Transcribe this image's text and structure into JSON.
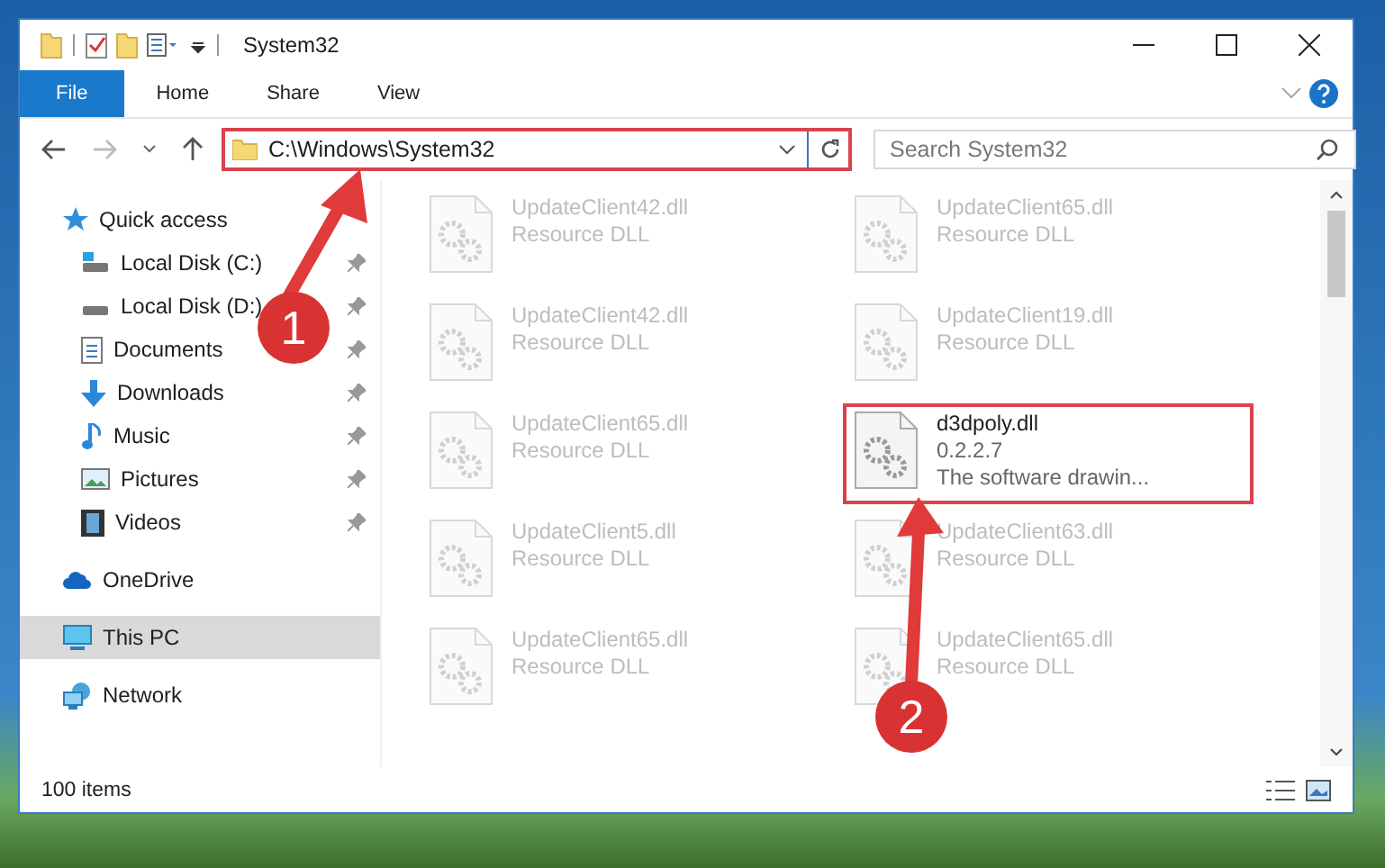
{
  "window": {
    "title": "System32"
  },
  "ribbon_tabs": [
    {
      "label": "File",
      "selected": true
    },
    {
      "label": "Home",
      "selected": false
    },
    {
      "label": "Share",
      "selected": false
    },
    {
      "label": "View",
      "selected": false
    }
  ],
  "address_bar": {
    "path": "C:\\Windows\\System32",
    "highlighted": true
  },
  "search": {
    "placeholder": "Search System32"
  },
  "sidebar": {
    "items": [
      {
        "label": "Quick access",
        "kind": "star",
        "selected": false,
        "children": [
          {
            "label": "Local Disk (C:)",
            "kind": "drive-c",
            "pinned": true,
            "selected": false
          },
          {
            "label": "Local Disk (D:)",
            "kind": "drive",
            "pinned": true,
            "selected": false
          },
          {
            "label": "Documents",
            "kind": "documents",
            "pinned": true,
            "selected": false
          },
          {
            "label": "Downloads",
            "kind": "downloads",
            "pinned": true,
            "selected": false
          },
          {
            "label": "Music",
            "kind": "music",
            "pinned": true,
            "selected": false
          },
          {
            "label": "Pictures",
            "kind": "pictures",
            "pinned": true,
            "selected": false
          },
          {
            "label": "Videos",
            "kind": "videos",
            "pinned": true,
            "selected": false
          }
        ]
      },
      {
        "label": "OneDrive",
        "kind": "cloud",
        "selected": false
      },
      {
        "label": "This PC",
        "kind": "computer",
        "selected": true
      },
      {
        "label": "Network",
        "kind": "network",
        "selected": false
      }
    ]
  },
  "files": [
    {
      "name": "UpdateClient42.dll",
      "type": "Resource DLL",
      "blurred": true,
      "highlighted": false
    },
    {
      "name": "UpdateClient65.dll",
      "type": "Resource DLL",
      "blurred": true,
      "highlighted": false
    },
    {
      "name": "UpdateClient42.dll",
      "type": "Resource DLL",
      "blurred": true,
      "highlighted": false
    },
    {
      "name": "UpdateClient19.dll",
      "type": "Resource DLL",
      "blurred": true,
      "highlighted": false
    },
    {
      "name": "UpdateClient65.dll",
      "type": "Resource DLL",
      "blurred": true,
      "highlighted": false
    },
    {
      "name": "d3dpoly.dll",
      "version": "0.2.2.7",
      "type": "The software drawin...",
      "blurred": false,
      "highlighted": true
    },
    {
      "name": "UpdateClient5.dll",
      "type": "Resource DLL",
      "blurred": true,
      "highlighted": false
    },
    {
      "name": "UpdateClient63.dll",
      "type": "Resource DLL",
      "blurred": true,
      "highlighted": false
    },
    {
      "name": "UpdateClient65.dll",
      "type": "Resource DLL",
      "blurred": true,
      "highlighted": false
    },
    {
      "name": "UpdateClient65.dll",
      "type": "Resource DLL",
      "blurred": true,
      "highlighted": false
    }
  ],
  "callouts": [
    {
      "number": "1"
    },
    {
      "number": "2"
    }
  ],
  "status_bar": {
    "item_count": "100 items"
  }
}
